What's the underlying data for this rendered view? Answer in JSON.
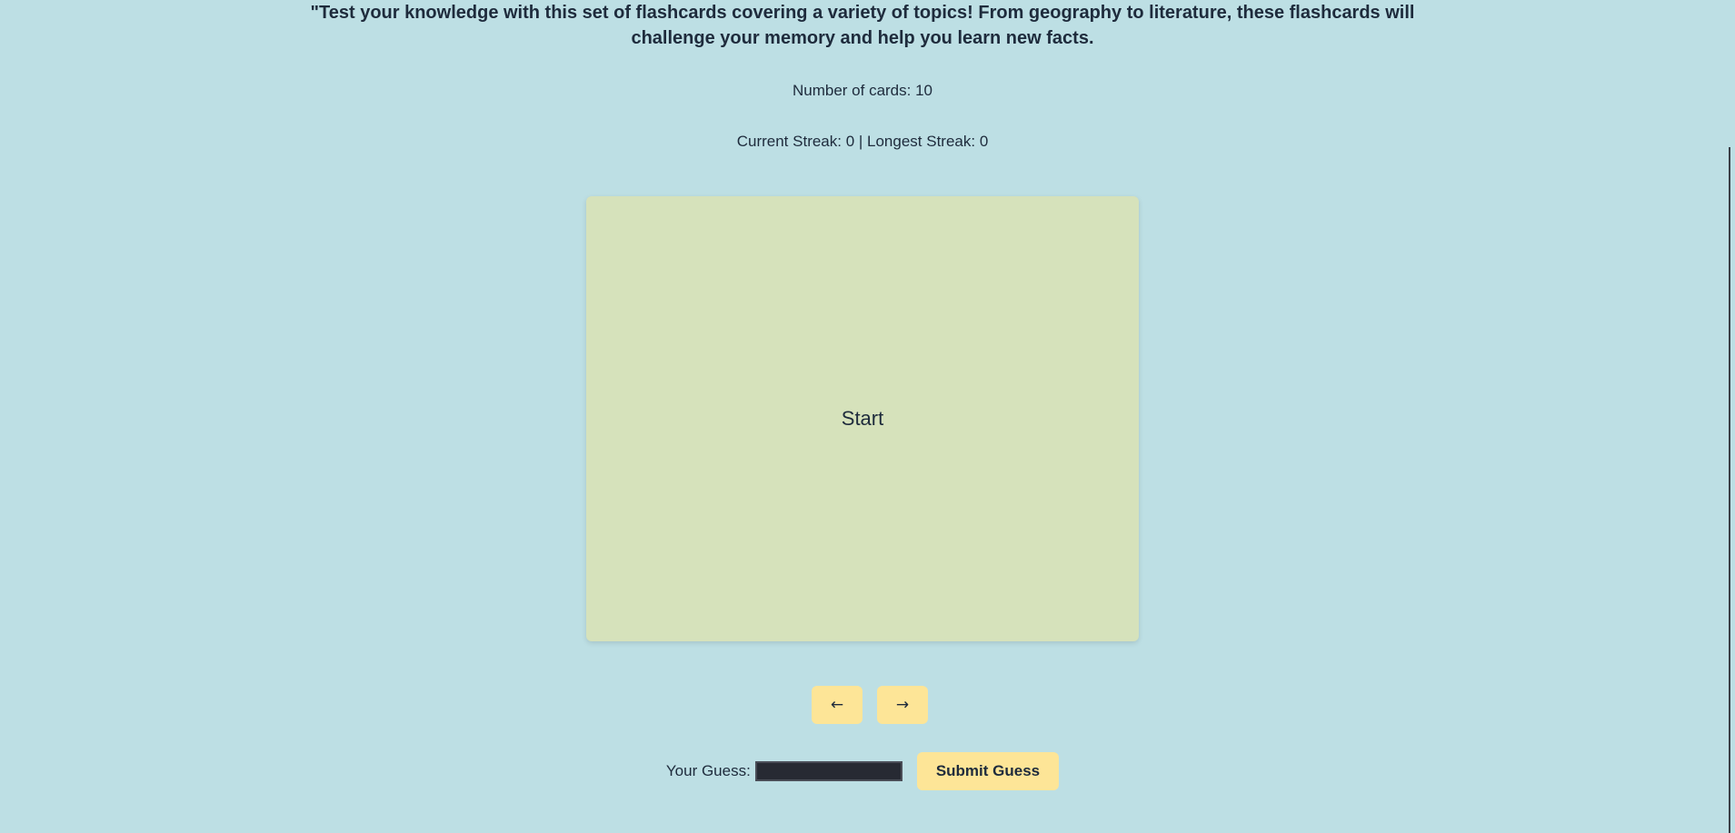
{
  "description": "\"Test your knowledge with this set of flashcards covering a variety of topics! From geography to literature, these flashcards will challenge your memory and help you learn new facts.",
  "card_count_text": "Number of cards: 10",
  "streak_text": "Current Streak: 0 | Longest Streak: 0",
  "flashcard": {
    "text": "Start"
  },
  "navigation": {
    "prev_label": "←",
    "next_label": "→"
  },
  "guess": {
    "label": "Your Guess:",
    "value": "",
    "submit_label": "Submit Guess"
  },
  "colors": {
    "background": "#bddfe4",
    "card": "#d6e2bb",
    "button": "#fde597",
    "text": "#1e2b3c"
  }
}
